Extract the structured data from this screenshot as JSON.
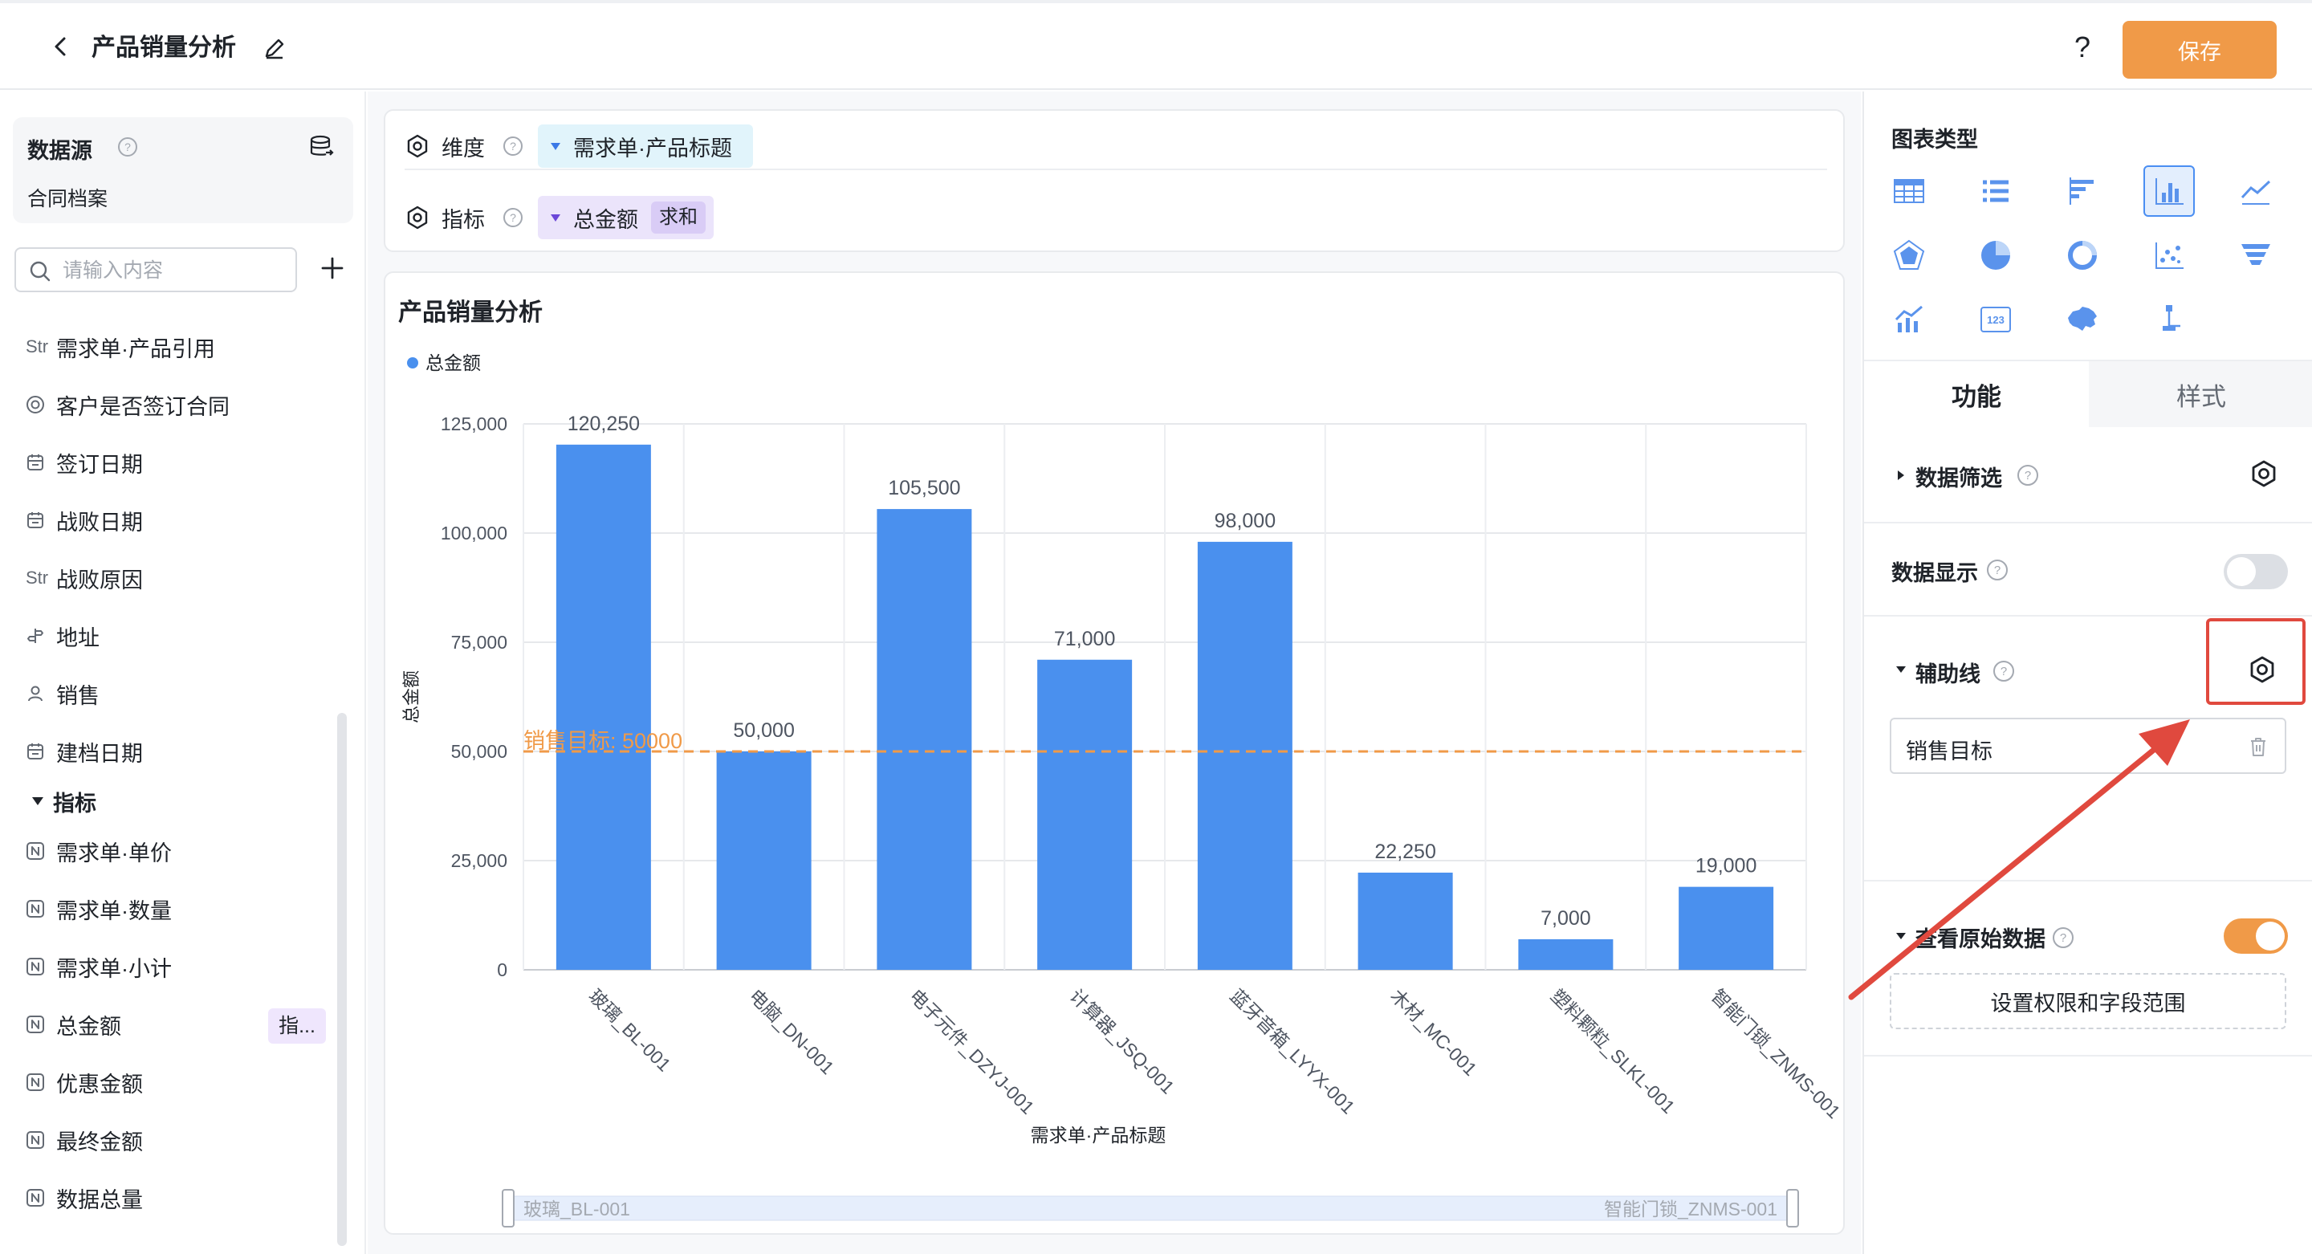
{
  "header": {
    "title": "产品销量分析",
    "help_label": "?",
    "save_label": "保存"
  },
  "sidebar": {
    "datasource_title": "数据源",
    "datasource_name": "合同档案",
    "search_placeholder": "请输入内容",
    "dimension_fields": [
      {
        "type": "Str",
        "label": "需求单·产品引用"
      },
      {
        "type": "radio-icon",
        "label": "客户是否签订合同"
      },
      {
        "type": "calendar-icon",
        "label": "签订日期"
      },
      {
        "type": "calendar-icon",
        "label": "战败日期"
      },
      {
        "type": "Str",
        "label": "战败原因"
      },
      {
        "type": "location-icon",
        "label": "地址"
      },
      {
        "type": "user-icon",
        "label": "销售"
      },
      {
        "type": "calendar-icon",
        "label": "建档日期"
      }
    ],
    "metrics_section_label": "指标",
    "metric_fields": [
      {
        "type": "N",
        "label": "需求单·单价"
      },
      {
        "type": "N",
        "label": "需求单·数量"
      },
      {
        "type": "N",
        "label": "需求单·小计"
      },
      {
        "type": "N",
        "label": "总金额",
        "badge": "指..."
      },
      {
        "type": "N",
        "label": "优惠金额"
      },
      {
        "type": "N",
        "label": "最终金额"
      },
      {
        "type": "N",
        "label": "数据总量"
      }
    ]
  },
  "config": {
    "dimension_label": "维度",
    "dimension_value": "需求单·产品标题",
    "metric_label": "指标",
    "metric_value": "总金额",
    "metric_agg": "求和"
  },
  "chart_data": {
    "type": "bar",
    "title": "产品销量分析",
    "legend": [
      "总金额"
    ],
    "legend_position": "top-left",
    "xlabel": "需求单·产品标题",
    "ylabel": "总金额",
    "categories": [
      "玻璃_BL-001",
      "电脑_DN-001",
      "电子元件_DZYJ-001",
      "计算器_JSQ-001",
      "蓝牙音箱_LYYX-001",
      "木材_MC-001",
      "塑料颗粒_SLKL-001",
      "智能门锁_ZNMS-001"
    ],
    "series": [
      {
        "name": "总金额",
        "values": [
          120250,
          50000,
          105500,
          71000,
          98000,
          22250,
          7000,
          19000
        ]
      }
    ],
    "value_labels": [
      "120,250",
      "50,000",
      "105,500",
      "71,000",
      "98,000",
      "22,250",
      "7,000",
      "19,000"
    ],
    "yticks": [
      "0",
      "25,000",
      "50,000",
      "75,000",
      "100,000",
      "125,000"
    ],
    "ylim": [
      0,
      125000
    ],
    "grid": true,
    "reference_line": {
      "label": "销售目标: 50000",
      "value": 50000
    },
    "bar_color": "#4a90ee",
    "reference_color": "#f09a48",
    "zoom_start_label": "玻璃_BL-001",
    "zoom_end_label": "智能门锁_ZNMS-001"
  },
  "right_panel": {
    "chart_type_title": "图表类型",
    "chart_types": [
      "table-icon",
      "list-icon",
      "horizontal-bar-icon",
      "bar-chart-icon",
      "line-chart-icon",
      "radar-icon",
      "pie-icon",
      "donut-icon",
      "scatter-icon",
      "funnel-icon",
      "combo-chart-icon",
      "number-card-icon",
      "map-icon",
      "tree-icon"
    ],
    "active_chart_type": "bar-chart-icon",
    "tab_function": "功能",
    "tab_style": "样式",
    "data_filter_label": "数据筛选",
    "data_display_label": "数据显示",
    "data_display_on": false,
    "aux_line_label": "辅助线",
    "aux_line_item": "销售目标",
    "raw_data_label": "查看原始数据",
    "raw_data_on": true,
    "perm_button_label": "设置权限和字段范围",
    "accent_color": "#f09a48"
  }
}
